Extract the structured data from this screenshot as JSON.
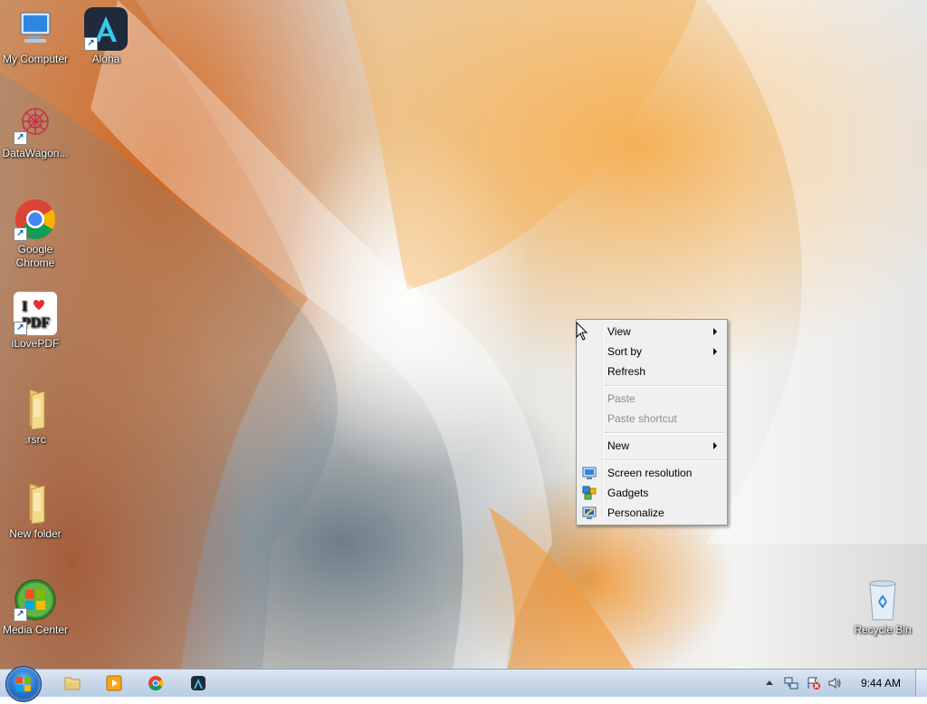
{
  "desktop_icons": [
    {
      "label": "My Computer",
      "icon": "computer-icon"
    },
    {
      "label": "Aloha",
      "icon": "aloha-browser-icon"
    },
    {
      "label": "DataWagon...",
      "icon": "datawagon-icon"
    },
    {
      "label": "Google Chrome",
      "icon": "chrome-icon"
    },
    {
      "label": "iLovePDF",
      "icon": "ilovepdf-icon"
    },
    {
      "label": ".rsrc",
      "icon": "folder-icon"
    },
    {
      "label": "New folder",
      "icon": "folder-icon"
    },
    {
      "label": "Media Center",
      "icon": "media-center-icon"
    },
    {
      "label": "Recycle Bin",
      "icon": "recycle-bin-icon"
    }
  ],
  "context_menu": {
    "items": [
      {
        "label": "View",
        "has_submenu": true,
        "enabled": true
      },
      {
        "label": "Sort by",
        "has_submenu": true,
        "enabled": true
      },
      {
        "label": "Refresh",
        "has_submenu": false,
        "enabled": true
      },
      {
        "label": "Paste",
        "has_submenu": false,
        "enabled": false
      },
      {
        "label": "Paste shortcut",
        "has_submenu": false,
        "enabled": false
      },
      {
        "label": "New",
        "has_submenu": true,
        "enabled": true
      },
      {
        "label": "Screen resolution",
        "has_submenu": false,
        "enabled": true,
        "icon": "screen-resolution-icon"
      },
      {
        "label": "Gadgets",
        "has_submenu": false,
        "enabled": true,
        "icon": "gadgets-icon"
      },
      {
        "label": "Personalize",
        "has_submenu": false,
        "enabled": true,
        "icon": "personalize-icon"
      }
    ]
  },
  "taskbar": {
    "pinned": [
      "explorer-icon",
      "media-player-icon",
      "chrome-icon",
      "aloha-browser-icon"
    ],
    "tray_icons": [
      "show-hidden-icons-arrow",
      "network-icon",
      "action-center-icon",
      "volume-icon"
    ],
    "clock": "9:44 AM"
  },
  "colors": {
    "taskbar": "#c9d8ea",
    "menu_bg": "#f0f0f0",
    "menu_border": "#979797",
    "disabled_text": "#8d8d8d"
  }
}
